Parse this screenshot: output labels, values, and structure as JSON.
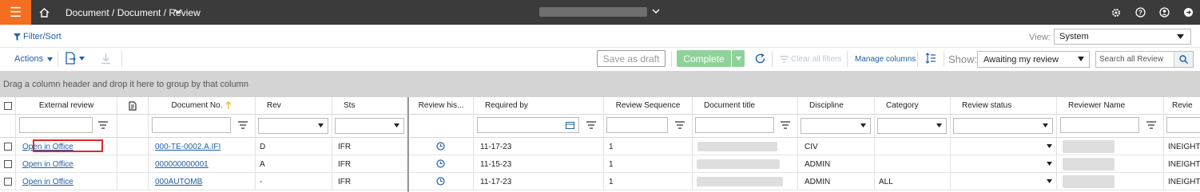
{
  "topbar": {
    "breadcrumb": "Document / Document / Review",
    "colors": {
      "background": "#3b3b3b",
      "menu_accent": "#f36e21"
    },
    "icons": [
      "menu-icon",
      "home-icon",
      "chevron-down-icon",
      "settings-icon",
      "help-icon",
      "account-icon",
      "logout-icon"
    ]
  },
  "filterbar": {
    "filter_label": "Filter/Sort",
    "view_label": "View:",
    "view_value": "System"
  },
  "toolbar": {
    "actions_label": "Actions",
    "save_draft_label": "Save as draft",
    "complete_label": "Complete",
    "clear_filters_label": "Clear all filters",
    "manage_columns_label": "Manage columns",
    "show_label": "Show:",
    "show_value": "Awaiting my review",
    "search_placeholder": "Search all Review",
    "colors": {
      "complete": "#8fd19a",
      "link": "#1f5fa6"
    }
  },
  "groupbar": {
    "text": "Drag a column header and drop it here to group by that column"
  },
  "grid": {
    "columns": {
      "external_review": "External review",
      "document_no": "Document No.",
      "rev": "Rev",
      "sts": "Sts",
      "review_history": "Review his...",
      "required_by": "Required by",
      "review_sequence": "Review Sequence",
      "document_title": "Document title",
      "discipline": "Discipline",
      "category": "Category",
      "review_status": "Review status",
      "reviewer_name": "Reviewer Name",
      "last": "Revie"
    },
    "rows": [
      {
        "external_review": "Open in Office",
        "document_no": "000-TE-0002.A.IFI",
        "rev": "D",
        "sts": "IFR",
        "required_by": "11-17-23",
        "review_sequence": "1",
        "discipline": "CIV",
        "category": "",
        "last": "INEIGHT"
      },
      {
        "external_review": "Open in Office",
        "document_no": "000000000001",
        "rev": "A",
        "sts": "IFR",
        "required_by": "11-15-23",
        "review_sequence": "1",
        "discipline": "ADMIN",
        "category": "",
        "last": "INEIGHT"
      },
      {
        "external_review": "Open in Office",
        "document_no": "000AUTOMB",
        "rev": "-",
        "sts": "IFR",
        "required_by": "11-17-23",
        "review_sequence": "1",
        "discipline": "ADMIN",
        "category": "ALL",
        "last": "INEIGHT"
      }
    ],
    "highlight_color": "#e0262b"
  }
}
